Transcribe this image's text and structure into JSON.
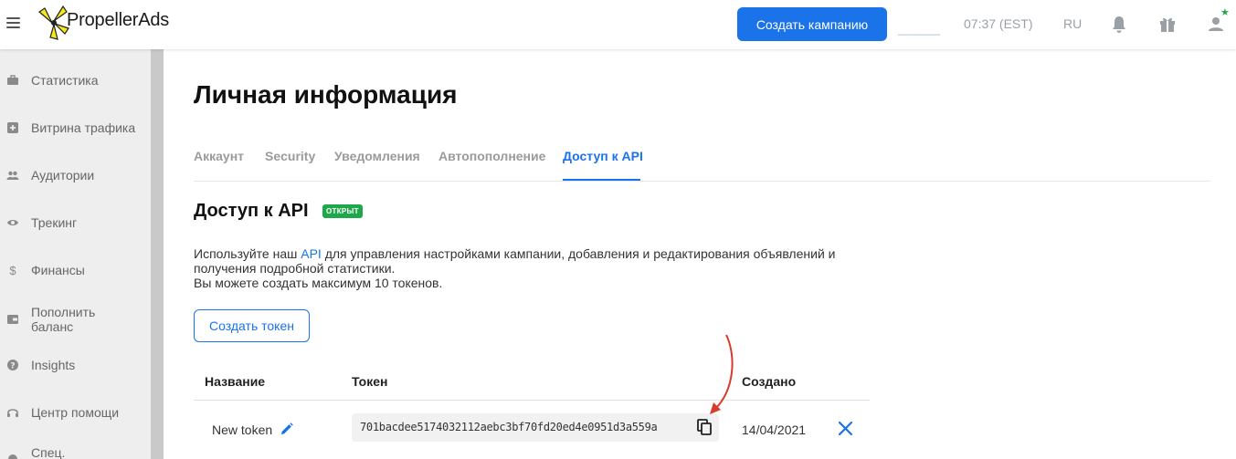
{
  "header": {
    "brand": "PropellerAds",
    "create_campaign_label": "Создать кампанию",
    "balance_placeholder": "______",
    "clock": "07:37 (EST)",
    "language": "RU",
    "icons": [
      "menu-icon",
      "bell-icon",
      "gift-icon",
      "user-icon"
    ],
    "colors": {
      "accent": "#1a73e8",
      "status_green": "#1fa84a"
    }
  },
  "sidebar": {
    "items": [
      {
        "label": "Статистика",
        "icon": "briefcase-icon"
      },
      {
        "label": "Витрина трафика",
        "icon": "plus-box-icon"
      },
      {
        "label": "Аудитории",
        "icon": "people-icon"
      },
      {
        "label": "Трекинг",
        "icon": "eye-icon"
      },
      {
        "label": "Финансы",
        "icon": "dollar-icon"
      },
      {
        "label": "Пополнить баланс",
        "icon": "wallet-icon"
      },
      {
        "label": "Insights",
        "icon": "help-circle-icon"
      },
      {
        "label": "Центр помощи",
        "icon": "headset-icon"
      },
      {
        "label": "Спец.",
        "icon": "special-icon"
      }
    ]
  },
  "main": {
    "page_title": "Личная информация",
    "tabs": [
      {
        "label": "Аккаунт",
        "active": false
      },
      {
        "label": "Security",
        "active": false
      },
      {
        "label": "Уведомления",
        "active": false
      },
      {
        "label": "Автопополнение",
        "active": false
      },
      {
        "label": "Доступ к API",
        "active": true
      }
    ],
    "api_section": {
      "title": "Доступ к API",
      "status_badge": "ОТКРЫТ",
      "description_prefix": "Используйте наш ",
      "description_link": "API",
      "description_suffix": " для управления настройками кампании, добавления и редактирования объявлений и получения подробной статистики.",
      "description_limit": "Вы можете создать максимум 10 токенов.",
      "create_token_label": "Создать токен"
    },
    "tokens_table": {
      "columns": [
        "Название",
        "Токен",
        "Создано"
      ],
      "rows": [
        {
          "name": "New token",
          "token": "701bacdee5174032112aebc3bf70fd20ed4e0951d3a559a",
          "created": "14/04/2021"
        }
      ]
    }
  }
}
